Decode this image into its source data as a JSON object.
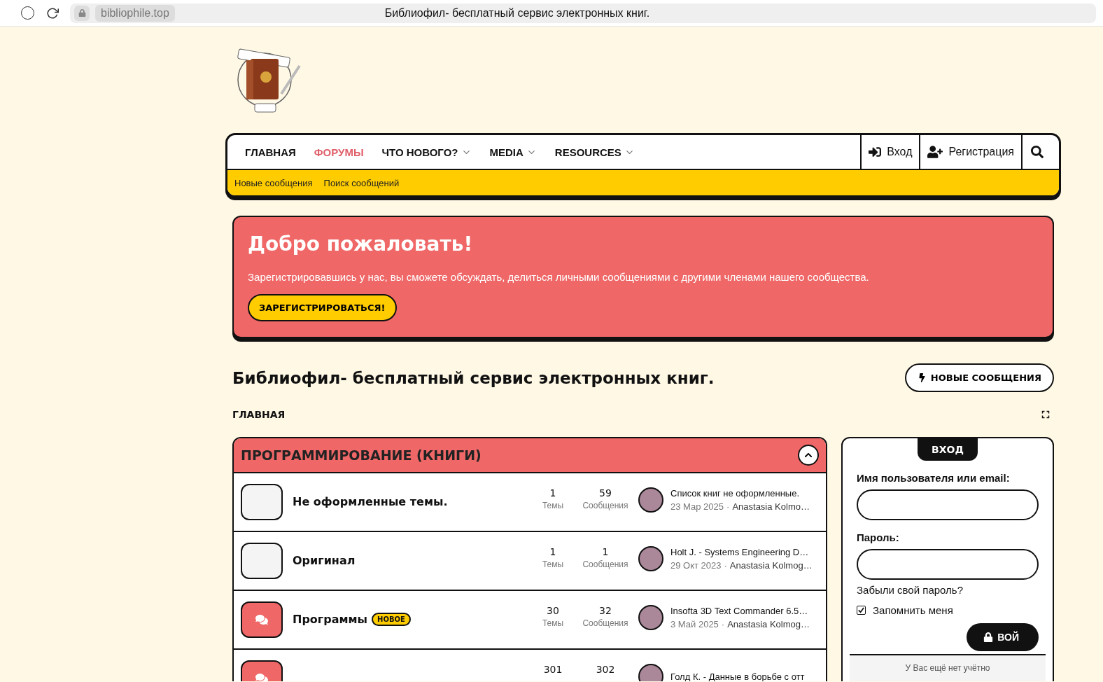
{
  "browser": {
    "url": "bibliophile.top",
    "title": "Библиофил- бесплатный сервис электронных книг."
  },
  "nav": {
    "items": [
      {
        "label": "ГЛАВНАЯ",
        "selected": false,
        "dropdown": false
      },
      {
        "label": "ФОРУМЫ",
        "selected": true,
        "dropdown": false
      },
      {
        "label": "ЧТО НОВОГО?",
        "selected": false,
        "dropdown": true
      },
      {
        "label": "MEDIA",
        "selected": false,
        "dropdown": true
      },
      {
        "label": "RESOURCES",
        "selected": false,
        "dropdown": true
      }
    ],
    "login": "Вход",
    "register": "Регистрация",
    "subnav": [
      "Новые сообщения",
      "Поиск сообщений"
    ]
  },
  "welcome": {
    "title": "Добро пожаловать!",
    "text": "Зарегистрировавшись у нас, вы сможете обсуждать, делиться личными сообщениями с другими членами нашего сообщества.",
    "button": "ЗАРЕГИСТРИРОВАТЬСЯ!"
  },
  "page_title": "Библиофил- бесплатный сервис электронных книг.",
  "new_posts_button": "НОВЫЕ СООБЩЕНИЯ",
  "breadcrumb": "ГЛАВНАЯ",
  "category": {
    "title": "ПРОГРАММИРОВАНИЕ (КНИГИ)",
    "expanded": true,
    "forums": [
      {
        "title": "Не оформленные темы.",
        "unread": false,
        "threads": "1",
        "threads_label": "Темы",
        "messages": "59",
        "messages_label": "Сообщения",
        "last_title": "Список книг не оформленные.",
        "last_date": "23 Мар 2025",
        "separator": "·",
        "last_user": "Anastasia Kolmo…"
      },
      {
        "title": "Оригинал",
        "unread": false,
        "threads": "1",
        "threads_label": "Темы",
        "messages": "1",
        "messages_label": "Сообщения",
        "last_title": "Holt J. - Systems Engineering D…",
        "last_date": "29 Окт 2023",
        "separator": "·",
        "last_user": "Anastasia Kolmog…"
      },
      {
        "title": "Программы",
        "unread": true,
        "badge": "НОВОЕ",
        "threads": "30",
        "threads_label": "Темы",
        "messages": "32",
        "messages_label": "Сообщения",
        "last_title": "Insofta 3D Text Commander 6.5…",
        "last_date": "3 Май 2025",
        "separator": "·",
        "last_user": "Anastasia Kolmog…"
      },
      {
        "unread": true,
        "threads": "301",
        "messages": "302",
        "last_title": "Голд К. - Данные в борьбе с отт"
      }
    ]
  },
  "login_box": {
    "title": "ВХОД",
    "user_label": "Имя пользователя или email:",
    "password_label": "Пароль:",
    "forgot": "Забыли свой пароль?",
    "remember": "Запомнить меня",
    "remember_checked": true,
    "submit": "ВОЙ",
    "no_account": "У Вас ещё нет учётно"
  }
}
